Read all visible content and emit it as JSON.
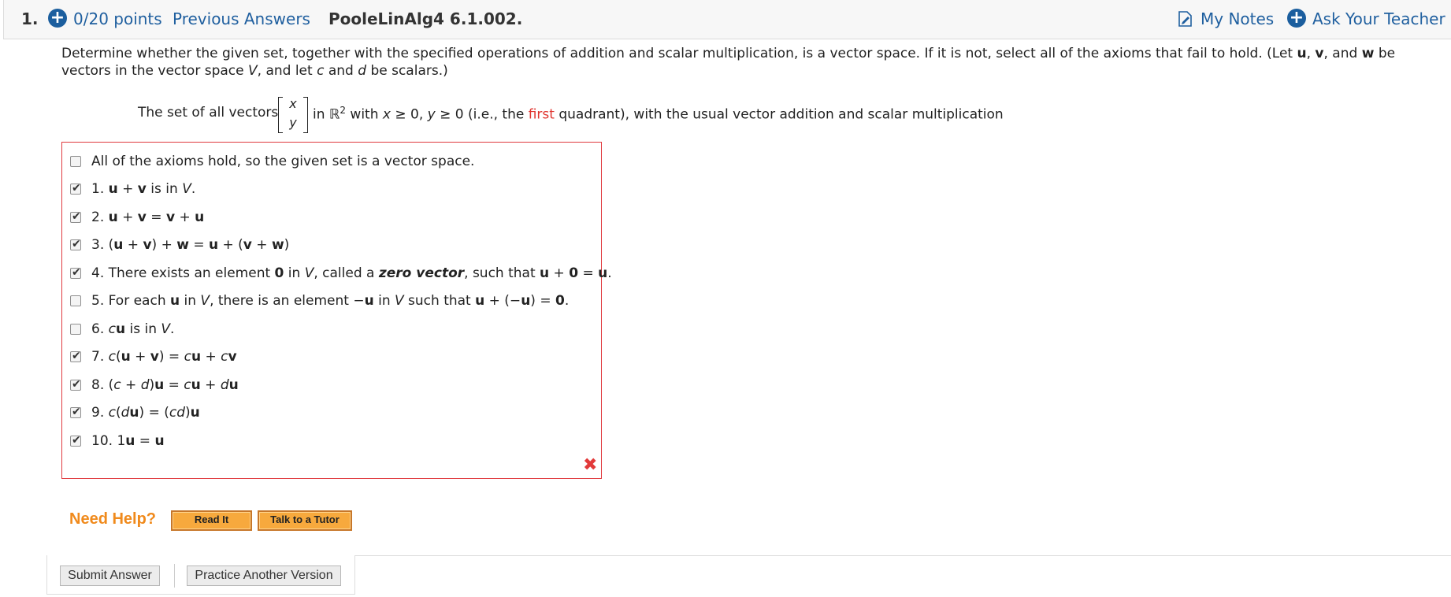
{
  "header": {
    "question_number": "1.",
    "points": "0/20 points",
    "previous_answers": "Previous Answers",
    "assignment_id": "PooleLinAlg4 6.1.002.",
    "my_notes": "My Notes",
    "ask_teacher": "Ask Your Teacher",
    "icons": [
      "plus-circle-icon",
      "notes-icon",
      "plus-circle-icon"
    ],
    "accent_color": "#1b5e9e"
  },
  "question": {
    "instructions_1": "Determine whether the given set, together with the specified operations of addition and scalar multiplication, is a vector space. If it is not, select all of the axioms that fail to hold. (Let ",
    "u": "u",
    "comma1": ", ",
    "v": "v",
    "and": ", and ",
    "w": "w",
    "instructions_2": " be vectors in the vector space ",
    "V": "V",
    "instructions_3": ", and let ",
    "c": "c",
    "and2": " and ",
    "d": "d",
    "instructions_4": " be scalars.)",
    "set_prefix": "The set of all vectors",
    "vec_top": "x",
    "vec_bottom": "y",
    "set_in": "in ℝ",
    "set_sup": "2",
    "set_with": " with ",
    "cond_x": "x",
    "cond_x_rel": " ≥ 0, ",
    "cond_y": "y",
    "cond_y_rel": " ≥ 0 (i.e., the ",
    "first_word": "first",
    "set_suffix": " quadrant), with the usual vector addition and scalar multiplication"
  },
  "options": [
    {
      "checked": false,
      "label": "All of the axioms hold, so the given set is a vector space."
    },
    {
      "checked": true,
      "label": "1. u + v is in V."
    },
    {
      "checked": true,
      "label": "2. u + v = v + u"
    },
    {
      "checked": true,
      "label": "3. (u + v) + w = u + (v + w)"
    },
    {
      "checked": true,
      "label": "4. There exists an element 0 in V, called a zero vector, such that u + 0 = u."
    },
    {
      "checked": false,
      "label": "5. For each u in V, there is an element −u in V such that u + (−u) = 0."
    },
    {
      "checked": false,
      "label": "6. cu is in V."
    },
    {
      "checked": true,
      "label": "7. c(u + v) = cu + cv"
    },
    {
      "checked": true,
      "label": "8. (c + d)u = cu + du"
    },
    {
      "checked": true,
      "label": "9. c(du) = (cd)u"
    },
    {
      "checked": true,
      "label": "10. 1u = u"
    }
  ],
  "result_icon": "incorrect-x-icon",
  "result_color": "#e23a3a",
  "help": {
    "need_help": "Need Help?",
    "read_it": "Read It",
    "talk_to_tutor": "Talk to a Tutor"
  },
  "footer": {
    "submit": "Submit Answer",
    "practice": "Practice Another Version"
  }
}
